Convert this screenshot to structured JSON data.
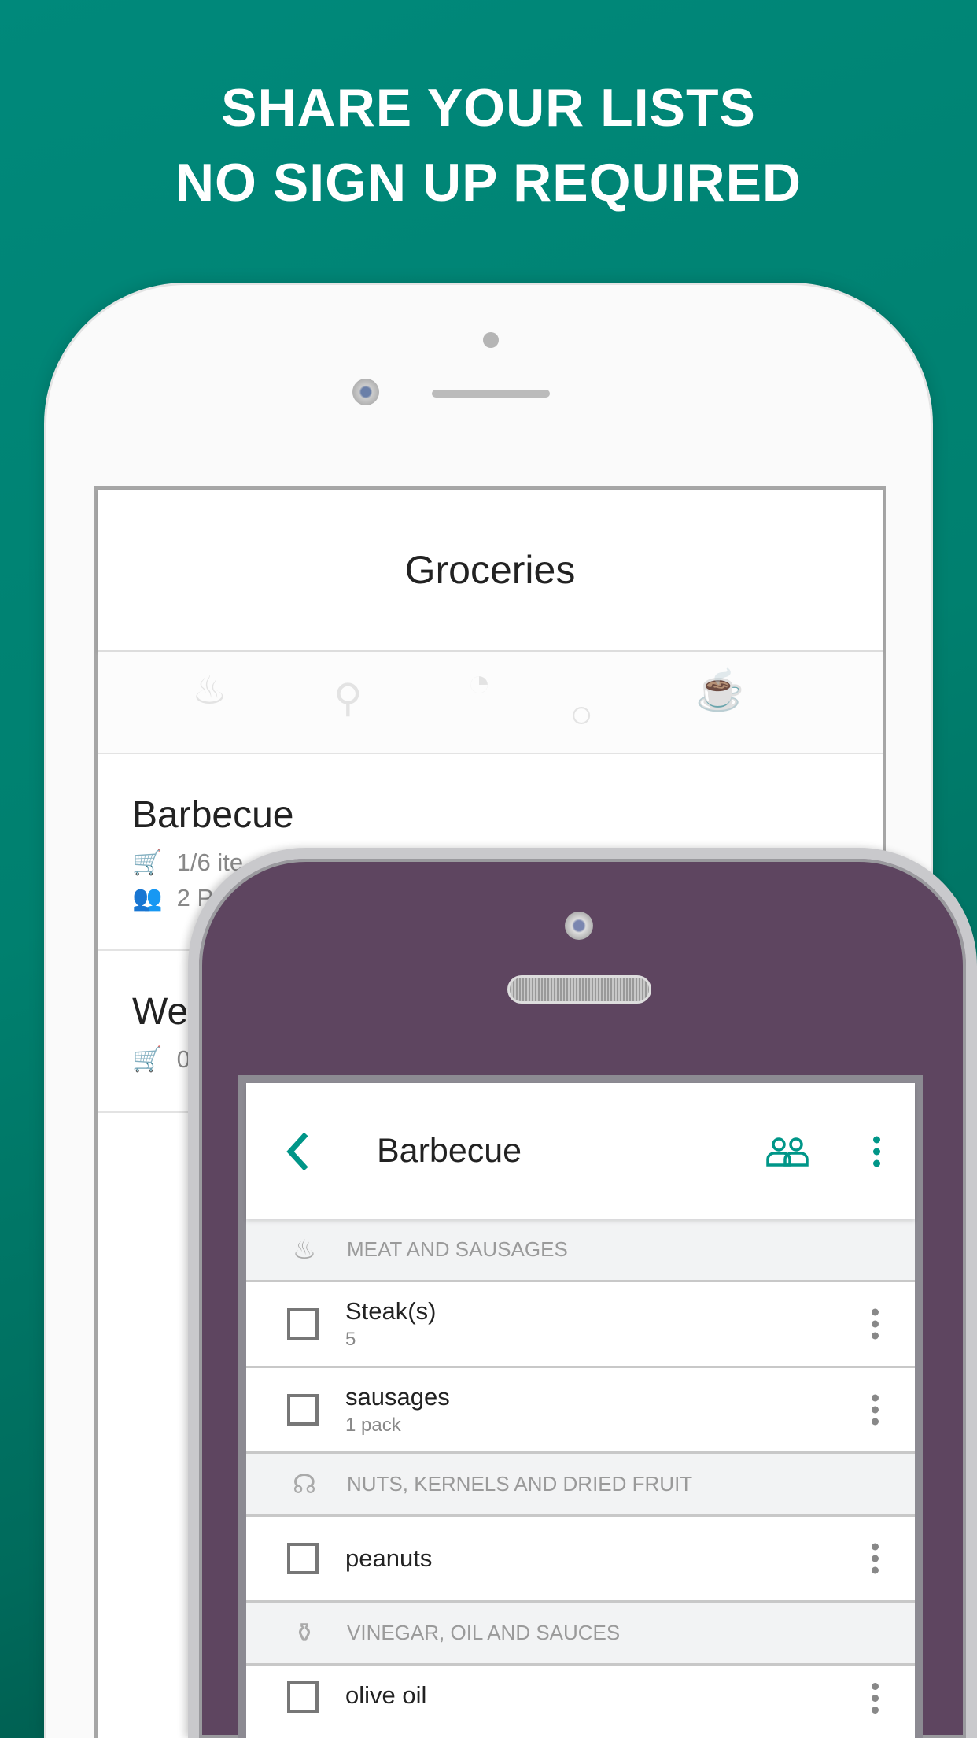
{
  "headline": {
    "line1": "SHARE YOUR LISTS",
    "line2": "NO SIGN UP REQUIRED"
  },
  "colors": {
    "background": "#00897b",
    "accent": "#009688",
    "front_phone": "#5e4560"
  },
  "back_phone": {
    "title": "Groceries",
    "lists": [
      {
        "name": "Barbecue",
        "items": "1/6 ite",
        "people": "2 P",
        "icons": [
          "cart-icon",
          "people-icon"
        ]
      },
      {
        "name": "We",
        "items": "0",
        "icons": [
          "cart-icon"
        ]
      }
    ]
  },
  "front_phone": {
    "title": "Barbecue",
    "icons": {
      "back": "chevron-left-icon",
      "share": "group-icon",
      "menu": "more-vertical-icon"
    },
    "sections": [
      {
        "name": "MEAT AND SAUSAGES",
        "icon": "steak-icon",
        "items": [
          {
            "name": "Steak(s)",
            "qty": "5"
          },
          {
            "name": "sausages",
            "qty": "1 pack"
          }
        ]
      },
      {
        "name": "NUTS, KERNELS AND DRIED FRUIT",
        "icon": "peanut-icon",
        "items": [
          {
            "name": "peanuts",
            "qty": ""
          }
        ]
      },
      {
        "name": "VINEGAR, OIL AND SAUCES",
        "icon": "oil-bottle-icon",
        "items": [
          {
            "name": "olive oil",
            "qty": ""
          }
        ]
      }
    ]
  }
}
